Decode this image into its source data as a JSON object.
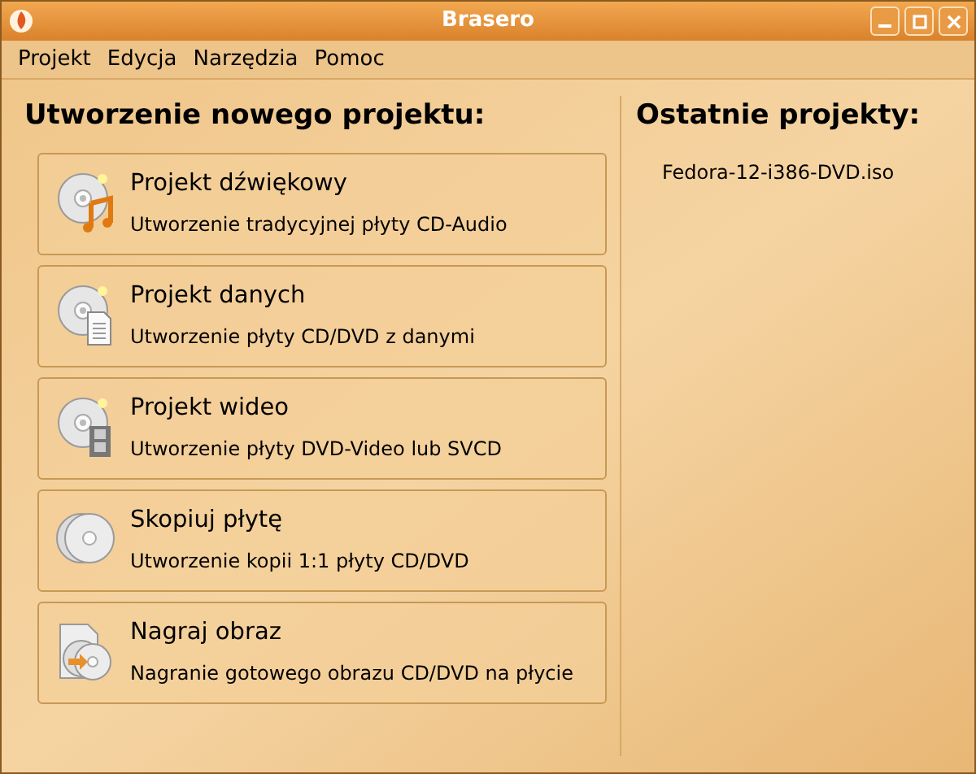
{
  "window": {
    "title": "Brasero"
  },
  "menu": [
    "Projekt",
    "Edycja",
    "Narzędzia",
    "Pomoc"
  ],
  "new_project": {
    "heading": "Utworzenie nowego projektu:",
    "items": [
      {
        "kind": "audio",
        "title": "Projekt dźwiękowy",
        "description": "Utworzenie tradycyjnej płyty CD-Audio"
      },
      {
        "kind": "data",
        "title": "Projekt danych",
        "description": "Utworzenie płyty CD/DVD z danymi"
      },
      {
        "kind": "video",
        "title": "Projekt wideo",
        "description": "Utworzenie płyty DVD-Video lub SVCD"
      },
      {
        "kind": "copy",
        "title": "Skopiuj płytę",
        "description": "Utworzenie kopii 1:1 płyty CD/DVD"
      },
      {
        "kind": "image",
        "title": "Nagraj obraz",
        "description": "Nagranie gotowego obrazu CD/DVD na płycie"
      }
    ]
  },
  "recent_projects": {
    "heading": "Ostatnie projekty:",
    "items": [
      "Fedora-12-i386-DVD.iso"
    ]
  }
}
